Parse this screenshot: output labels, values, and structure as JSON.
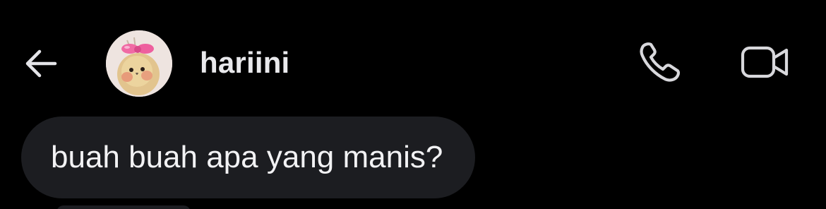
{
  "header": {
    "username": "hariini",
    "back_icon": "arrow-left-icon",
    "call_icon": "phone-icon",
    "video_icon": "video-camera-icon"
  },
  "messages": [
    {
      "text": "buah buah apa yang manis?",
      "direction": "incoming"
    }
  ],
  "colors": {
    "background": "#000000",
    "bubble": "#1c1d21",
    "text": "#f2f2f4",
    "icon": "#dcdce0"
  }
}
